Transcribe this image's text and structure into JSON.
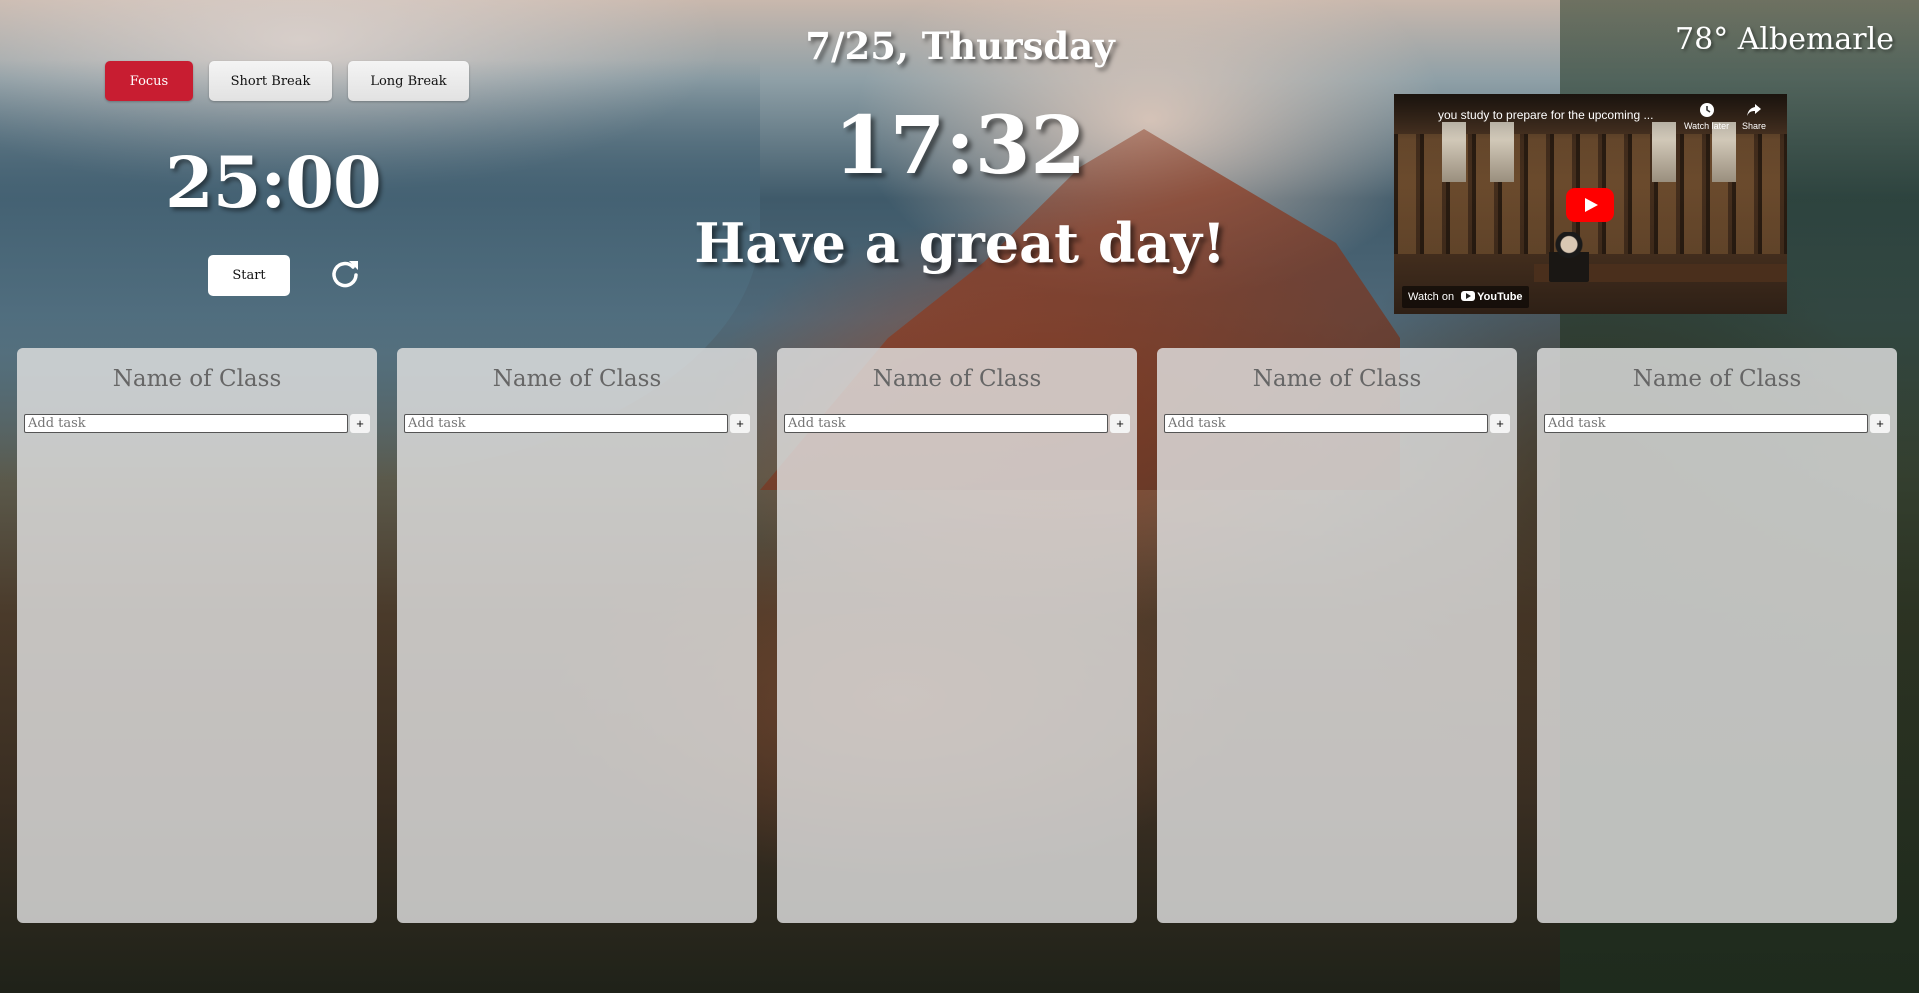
{
  "timer": {
    "modes": [
      "Focus",
      "Short Break",
      "Long Break"
    ],
    "active_mode": "Focus",
    "time": "25:00",
    "start_label": "Start",
    "reset_icon": "reset-icon",
    "colors": {
      "focus": "#c81d31"
    }
  },
  "header": {
    "date": "7/25, Thursday",
    "clock": "17:32",
    "greeting": "Have a great day!",
    "weather": "78° Albemarle"
  },
  "video": {
    "title": "you study to prepare for the upcoming ...",
    "watch_later": "Watch later",
    "share": "Share",
    "watch_on": "Watch on",
    "brand": "YouTube"
  },
  "classes": [
    {
      "title": "Name of Class",
      "placeholder": "Add task",
      "add_label": "+"
    },
    {
      "title": "Name of Class",
      "placeholder": "Add task",
      "add_label": "+"
    },
    {
      "title": "Name of Class",
      "placeholder": "Add task",
      "add_label": "+"
    },
    {
      "title": "Name of Class",
      "placeholder": "Add task",
      "add_label": "+"
    },
    {
      "title": "Name of Class",
      "placeholder": "Add task",
      "add_label": "+"
    }
  ]
}
